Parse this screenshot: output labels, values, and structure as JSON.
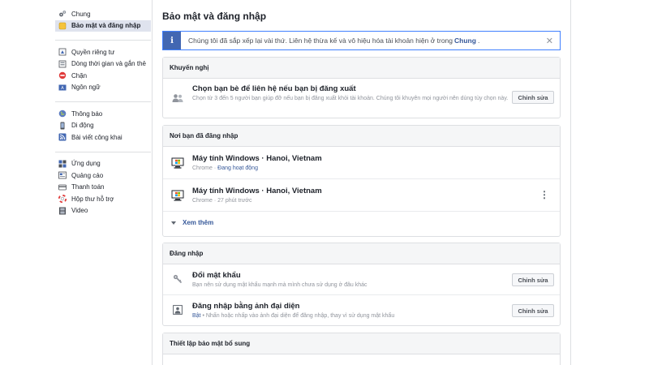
{
  "sidebar": {
    "groups": [
      [
        {
          "label": "Chung",
          "icon": "gears-icon"
        },
        {
          "label": "Bảo mật và đăng nhập",
          "icon": "shield-icon",
          "active": true
        }
      ],
      [
        {
          "label": "Quyền riêng tư",
          "icon": "lock-icon"
        },
        {
          "label": "Dòng thời gian và gắn thẻ",
          "icon": "timeline-icon"
        },
        {
          "label": "Chặn",
          "icon": "block-icon"
        },
        {
          "label": "Ngôn ngữ",
          "icon": "language-icon"
        }
      ],
      [
        {
          "label": "Thông báo",
          "icon": "globe-icon"
        },
        {
          "label": "Di động",
          "icon": "mobile-icon"
        },
        {
          "label": "Bài viết công khai",
          "icon": "rss-icon"
        }
      ],
      [
        {
          "label": "Ứng dụng",
          "icon": "apps-icon"
        },
        {
          "label": "Quảng cáo",
          "icon": "ads-icon"
        },
        {
          "label": "Thanh toán",
          "icon": "payment-icon"
        },
        {
          "label": "Hộp thư hỗ trợ",
          "icon": "support-icon"
        },
        {
          "label": "Video",
          "icon": "video-icon"
        }
      ]
    ]
  },
  "page": {
    "title": "Bảo mật và đăng nhập"
  },
  "notice": {
    "icon_letter": "i",
    "text": "Chúng tôi đã sắp xếp lại vài thứ. Liên hệ thừa kế và vô hiệu hóa tài khoản hiện ở trong",
    "link": "Chung",
    "suffix": ".",
    "close": "✕"
  },
  "recommended": {
    "header": "Khuyến nghị",
    "title": "Chọn bạn bè để liên hệ nếu bạn bị đăng xuất",
    "desc": "Chọn từ 3 đến 5 người bạn giúp đỡ nếu bạn bị đăng xuất khỏi tài khoản. Chúng tôi khuyên mọi người nên dùng tùy chọn này.",
    "button": "Chỉnh sửa"
  },
  "where_logged_in": {
    "header": "Nơi bạn đã đăng nhập",
    "sessions": [
      {
        "device": "Máy tính Windows · Hanoi, Vietnam",
        "browser": "Chrome",
        "sep": " · ",
        "status": "Đang hoạt động",
        "active": true
      },
      {
        "device": "Máy tính Windows · Hanoi, Vietnam",
        "browser": "Chrome",
        "sep": " · ",
        "status": "27 phút trước",
        "active": false
      }
    ],
    "see_more": "Xem thêm",
    "kebab": "⋮"
  },
  "login": {
    "header": "Đăng nhập",
    "items": [
      {
        "title": "Đổi mật khẩu",
        "desc": "Bạn nên sử dụng mật khẩu mạnh mà mình chưa sử dụng ở đâu khác",
        "button": "Chỉnh sửa"
      },
      {
        "title": "Đăng nhập bằng ảnh đại diện",
        "status": "Bật",
        "desc": " • Nhấn hoặc nhấp vào ảnh đại diện để đăng nhập, thay vì sử dụng mật khẩu",
        "button": "Chỉnh sửa"
      }
    ]
  },
  "extra": {
    "header": "Thiết lập bảo mật bổ sung"
  },
  "colors": {
    "accent": "#4267b2",
    "link": "#365899",
    "active_bg": "#dfe3ee"
  }
}
